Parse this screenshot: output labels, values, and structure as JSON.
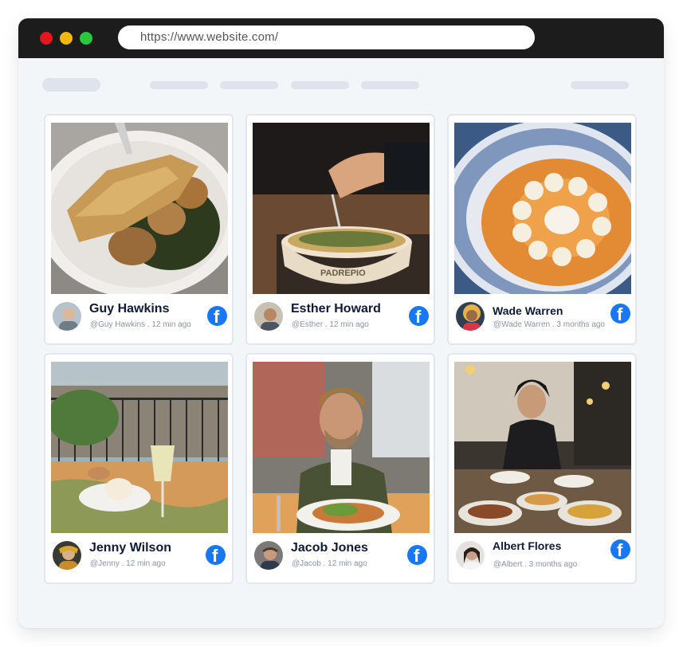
{
  "browser": {
    "url": "https://www.website.com/",
    "traffic_lights": {
      "red": "#e5161e",
      "yellow": "#f0b90b",
      "green": "#28c840"
    }
  },
  "network_icon": "facebook-icon",
  "accent_color": "#1877f2",
  "posts": [
    {
      "name": "Guy Hawkins",
      "meta": "@Guy Hawkins . 12 min ago",
      "photo": "roasted-fish-with-potatoes-and-spinach"
    },
    {
      "name": "Esther Howard",
      "meta": "@Esther . 12 min ago",
      "photo": "noodle-bowl-with-fork"
    },
    {
      "name": "Wade Warren",
      "meta": "@Wade Warren . 3 months ago",
      "photo": "orange-soup-in-patterned-bowl"
    },
    {
      "name": "Jenny Wilson",
      "meta": "@Jenny . 12 min ago",
      "photo": "balcony-table-with-drinks"
    },
    {
      "name": "Jacob Jones",
      "meta": "@Jacob . 12 min ago",
      "photo": "man-eating-salad"
    },
    {
      "name": "Albert Flores",
      "meta": "@Albert . 3 months ago",
      "photo": "woman-with-buffet-table"
    }
  ]
}
